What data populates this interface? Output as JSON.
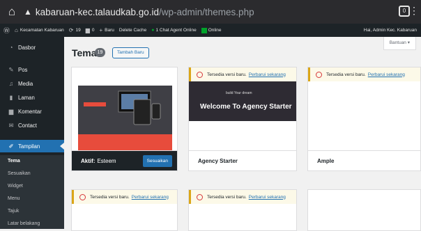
{
  "browser": {
    "url_host": "kabaruan-kec.talaudkab.go.id",
    "url_path": "/wp-admin/themes.php",
    "ext_badge": "0"
  },
  "adminbar": {
    "site_name": "Kecamatan Kabaruan",
    "updates": "19",
    "comments": "0",
    "new_label": "Baru",
    "delete_cache": "Delete Cache",
    "chat_agent": "1 Chat Agent Online",
    "online": "Online",
    "howdy": "Hai, Admin Kec. Kabaruan"
  },
  "sidebar": {
    "items": [
      {
        "label": "Dasbor",
        "icon": "dashboard-icon"
      },
      {
        "label": "Pos",
        "icon": "pin-icon"
      },
      {
        "label": "Media",
        "icon": "media-icon"
      },
      {
        "label": "Laman",
        "icon": "page-icon"
      },
      {
        "label": "Komentar",
        "icon": "comment-icon"
      },
      {
        "label": "Contact",
        "icon": "mail-icon"
      },
      {
        "label": "Tampilan",
        "icon": "brush-icon"
      }
    ],
    "submenu": [
      "Tema",
      "Sesuaikan",
      "Widget",
      "Menu",
      "Tajuk",
      "Latar belakang"
    ]
  },
  "page": {
    "title": "Tema",
    "count": "19",
    "add_new": "Tambah Baru",
    "help": "Bantuan ▾"
  },
  "themes": [
    {
      "name": "Esteem",
      "active_label": "Aktif:",
      "customize": "Sesuaikan"
    },
    {
      "name": "Agency Starter",
      "notice": "Tersedia versi baru.",
      "notice_link": "Perbarui sekarang",
      "banner_title": "Welcome To Agency Starter",
      "banner_sub": "build Your dream"
    },
    {
      "name": "Ample",
      "notice": "Tersedia versi baru.",
      "notice_link": "Perbarui sekarang"
    },
    {
      "notice": "Tersedia versi baru.",
      "notice_link": "Perbarui sekarang"
    },
    {
      "notice": "Tersedia versi baru.",
      "notice_link": "Perbarui sekarang"
    }
  ],
  "colors": {
    "admin_bg": "#1d2327",
    "accent": "#2271b1",
    "notice_border": "#dba617",
    "notice_icon": "#d63638"
  }
}
